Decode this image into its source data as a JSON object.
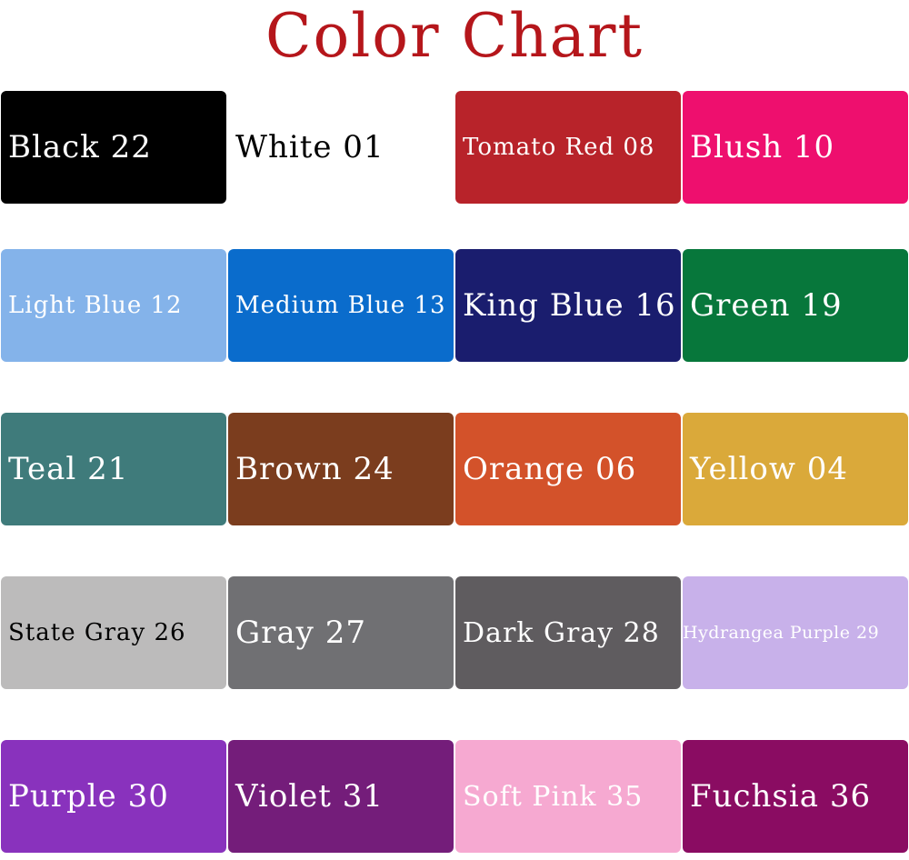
{
  "title": "Color Chart",
  "colors": {
    "title": "#b5161b"
  },
  "swatches": [
    {
      "label": "Black 22",
      "color": "#000000",
      "text_color": "#ffffff"
    },
    {
      "label": "White 01",
      "color": "#ffffff",
      "text_color": "#000000"
    },
    {
      "label": "Tomato Red 08",
      "color": "#b8232a",
      "text_color": "#ffffff"
    },
    {
      "label": "Blush 10",
      "color": "#ee0f6e",
      "text_color": "#ffffff"
    },
    {
      "label": "Light Blue 12",
      "color": "#84b3ea",
      "text_color": "#ffffff"
    },
    {
      "label": "Medium Blue 13",
      "color": "#0a6ccc",
      "text_color": "#ffffff"
    },
    {
      "label": "King Blue 16",
      "color": "#1a1d6e",
      "text_color": "#ffffff"
    },
    {
      "label": "Green 19",
      "color": "#07773b",
      "text_color": "#ffffff"
    },
    {
      "label": "Teal 21",
      "color": "#3f7b7b",
      "text_color": "#ffffff"
    },
    {
      "label": "Brown 24",
      "color": "#7b3d1e",
      "text_color": "#ffffff"
    },
    {
      "label": "Orange 06",
      "color": "#d3522a",
      "text_color": "#ffffff"
    },
    {
      "label": "Yellow 04",
      "color": "#daa93a",
      "text_color": "#ffffff"
    },
    {
      "label": "State Gray 26",
      "color": "#bcbbbb",
      "text_color": "#000000"
    },
    {
      "label": "Gray 27",
      "color": "#707073",
      "text_color": "#ffffff"
    },
    {
      "label": "Dark Gray 28",
      "color": "#5f5c5f",
      "text_color": "#ffffff"
    },
    {
      "label": "Hydrangea Purple 29",
      "color": "#c8b1ea",
      "text_color": "#ffffff"
    },
    {
      "label": "Purple 30",
      "color": "#8932bd",
      "text_color": "#ffffff"
    },
    {
      "label": "Violet 31",
      "color": "#741d7a",
      "text_color": "#ffffff"
    },
    {
      "label": "Soft Pink 35",
      "color": "#f6a9d1",
      "text_color": "#ffffff"
    },
    {
      "label": "Fuchsia 36",
      "color": "#8a0c62",
      "text_color": "#ffffff"
    }
  ]
}
